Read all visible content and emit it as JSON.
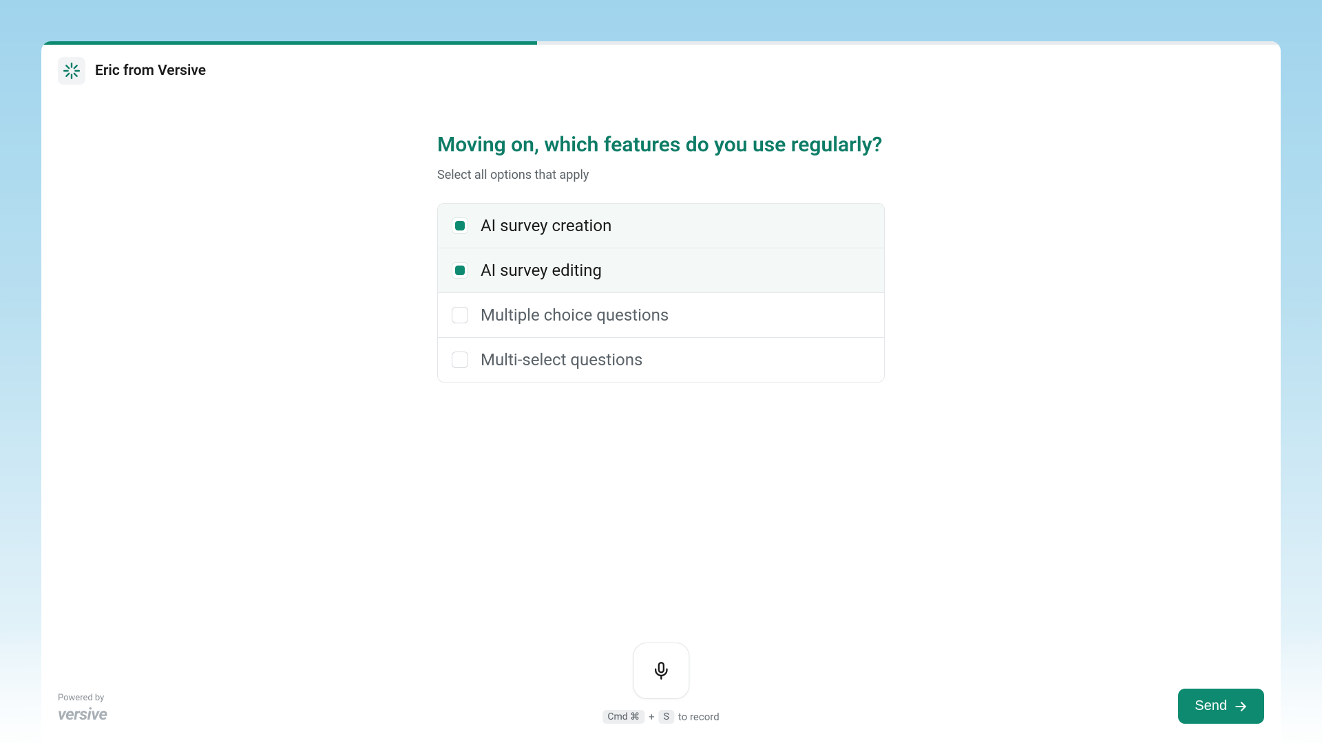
{
  "header": {
    "title": "Eric from Versive"
  },
  "progress": {
    "percent": 40
  },
  "survey": {
    "question": "Moving on, which features do you use regularly?",
    "subtitle": "Select all options that apply",
    "options": [
      {
        "label": "AI survey creation",
        "selected": true
      },
      {
        "label": "AI survey editing",
        "selected": true
      },
      {
        "label": "Multiple choice questions",
        "selected": false
      },
      {
        "label": "Multi-select questions",
        "selected": false
      }
    ]
  },
  "footer": {
    "powered_label": "Powered by",
    "brand": "versive",
    "hint_key1": "Cmd ⌘",
    "hint_plus": "+",
    "hint_key2": "S",
    "hint_text": "to record",
    "send_label": "Send"
  }
}
